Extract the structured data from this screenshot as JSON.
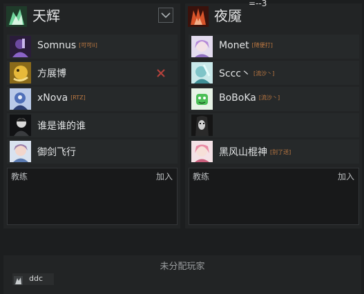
{
  "score_overlay": "=--3",
  "teams": [
    {
      "name": "天辉",
      "emblem_icon": "radiant-emblem-icon",
      "players": [
        {
          "name": "Somnus",
          "tag": "[可可ii]",
          "avatar_icon": "purple-hero-avatar-icon"
        },
        {
          "name": "方展博",
          "tag": "",
          "avatar_icon": "yellow-creature-avatar-icon"
        },
        {
          "name": "xNova",
          "tag": "[RTZ]",
          "avatar_icon": "blue-hero-avatar-icon"
        },
        {
          "name": "谁是谁的谁",
          "tag": "",
          "avatar_icon": "dark-figure-avatar-icon"
        },
        {
          "name": "御剑飞行",
          "tag": "",
          "avatar_icon": "anime-girl-avatar-icon"
        }
      ],
      "coach_label": "教练",
      "join_label": "加入"
    },
    {
      "name": "夜魇",
      "emblem_icon": "dire-emblem-icon",
      "players": [
        {
          "name": "Monet",
          "tag": "[随便打]",
          "avatar_icon": "purple-hair-avatar-icon"
        },
        {
          "name": "Sccc丶",
          "tag": "[流沙丶]",
          "avatar_icon": "cyan-avatar-icon"
        },
        {
          "name": "BoBoKa",
          "tag": "[流沙丶]",
          "avatar_icon": "green-cartoon-avatar-icon"
        },
        {
          "name": "",
          "tag": "",
          "avatar_icon": "dark-portrait-avatar-icon"
        },
        {
          "name": "黑风山棍神",
          "tag": "[别了送]",
          "avatar_icon": "pink-hair-avatar-icon"
        }
      ],
      "coach_label": "教练",
      "join_label": "加入"
    }
  ],
  "unassigned": {
    "title": "未分配玩家",
    "players": [
      {
        "name": "ddc",
        "avatar_icon": "small-player-avatar-icon"
      }
    ]
  },
  "colors": {
    "tag": "#c07a42",
    "remove": "#b8423c",
    "slot_bg": "#26292a"
  }
}
